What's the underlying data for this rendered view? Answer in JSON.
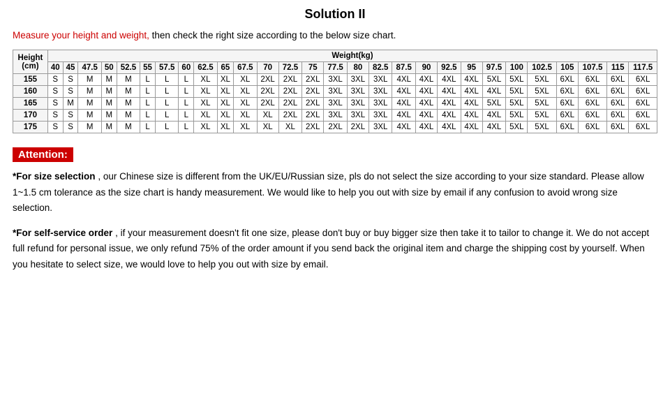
{
  "title": "Solution II",
  "intro": {
    "highlight": "Measure your height and weight,",
    "rest": " then check the right size according to the below size chart."
  },
  "table": {
    "height_label": "Height\n(cm)",
    "weight_label": "Weight(kg)",
    "weight_cols": [
      "40",
      "45",
      "47.5",
      "50",
      "52.5",
      "55",
      "57.5",
      "60",
      "62.5",
      "65",
      "67.5",
      "70",
      "72.5",
      "75",
      "77.5",
      "80",
      "82.5",
      "87.5",
      "90",
      "92.5",
      "95",
      "97.5",
      "100",
      "102.5",
      "105",
      "107.5",
      "115",
      "117.5"
    ],
    "rows": [
      {
        "height": "155",
        "sizes": [
          "S",
          "S",
          "M",
          "M",
          "M",
          "L",
          "L",
          "L",
          "XL",
          "XL",
          "XL",
          "2XL",
          "2XL",
          "2XL",
          "3XL",
          "3XL",
          "3XL",
          "4XL",
          "4XL",
          "4XL",
          "4XL",
          "5XL",
          "5XL",
          "5XL",
          "6XL",
          "6XL",
          "6XL",
          "6XL"
        ]
      },
      {
        "height": "160",
        "sizes": [
          "S",
          "S",
          "M",
          "M",
          "M",
          "L",
          "L",
          "L",
          "XL",
          "XL",
          "XL",
          "2XL",
          "2XL",
          "2XL",
          "3XL",
          "3XL",
          "3XL",
          "4XL",
          "4XL",
          "4XL",
          "4XL",
          "4XL",
          "5XL",
          "5XL",
          "6XL",
          "6XL",
          "6XL",
          "6XL"
        ]
      },
      {
        "height": "165",
        "sizes": [
          "S",
          "M",
          "M",
          "M",
          "M",
          "L",
          "L",
          "L",
          "XL",
          "XL",
          "XL",
          "2XL",
          "2XL",
          "2XL",
          "3XL",
          "3XL",
          "3XL",
          "4XL",
          "4XL",
          "4XL",
          "4XL",
          "5XL",
          "5XL",
          "5XL",
          "6XL",
          "6XL",
          "6XL",
          "6XL"
        ]
      },
      {
        "height": "170",
        "sizes": [
          "S",
          "S",
          "M",
          "M",
          "M",
          "L",
          "L",
          "L",
          "XL",
          "XL",
          "XL",
          "XL",
          "2XL",
          "2XL",
          "3XL",
          "3XL",
          "3XL",
          "4XL",
          "4XL",
          "4XL",
          "4XL",
          "4XL",
          "5XL",
          "5XL",
          "6XL",
          "6XL",
          "6XL",
          "6XL"
        ]
      },
      {
        "height": "175",
        "sizes": [
          "S",
          "S",
          "M",
          "M",
          "M",
          "L",
          "L",
          "L",
          "XL",
          "XL",
          "XL",
          "XL",
          "XL",
          "2XL",
          "2XL",
          "2XL",
          "3XL",
          "4XL",
          "4XL",
          "4XL",
          "4XL",
          "4XL",
          "5XL",
          "5XL",
          "6XL",
          "6XL",
          "6XL",
          "6XL"
        ]
      }
    ]
  },
  "attention": {
    "label": "Attention:",
    "para1_bold": "*For size selection",
    "para1_rest": ", our Chinese size is different from the UK/EU/Russian size, pls do not select the size according to your size standard. Please allow 1~1.5 cm tolerance as the size chart is handy measurement. We would like to help you out with size by email if any confusion to avoid wrong size selection.",
    "para2_bold": "*For self-service order",
    "para2_rest": ", if your measurement doesn't fit one size, please don't buy or buy bigger size then take it to tailor to change it. We do not accept full refund for personal issue, we only refund 75% of the order amount if you send back the original item and charge the shipping cost by yourself.  When you hesitate to select size, we would love to help you out with size by email."
  }
}
